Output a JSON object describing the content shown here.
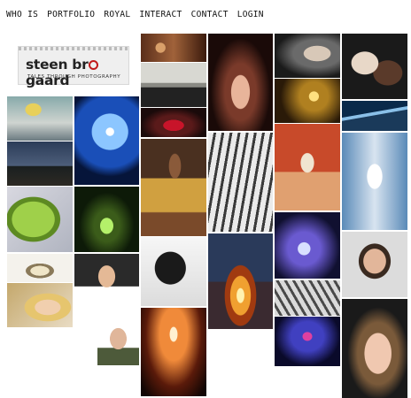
{
  "nav": {
    "items": [
      "WHO IS",
      "PORTFOLIO",
      "ROYAL",
      "INTERACT",
      "CONTACT",
      "LOGIN"
    ]
  },
  "logo": {
    "name_before": "steen br",
    "name_after": "gaard",
    "tagline": "TALES THROUGH PHOTOGRAPHY",
    "accent_color": "#c01a1a"
  },
  "gallery": {
    "thumbnails": [
      "masked-figure",
      "backlit-profile",
      "night-field",
      "leaf-macro",
      "caterpillar",
      "bracelet",
      "smiling-man",
      "blonde-woman",
      "bald-man",
      "beads-closeup",
      "men-in-hats",
      "red-lips",
      "indian-woman",
      "silhouette-hair",
      "dancing-crowd",
      "hand-gesture",
      "dancers-bw",
      "bonfire",
      "old-woman",
      "candle-room",
      "palace-girl",
      "jellyfish-light",
      "bw-crowd",
      "blue-dancers",
      "couple-embrace",
      "glass-curve",
      "fashion-model",
      "young-man",
      "smiling-woman"
    ]
  }
}
